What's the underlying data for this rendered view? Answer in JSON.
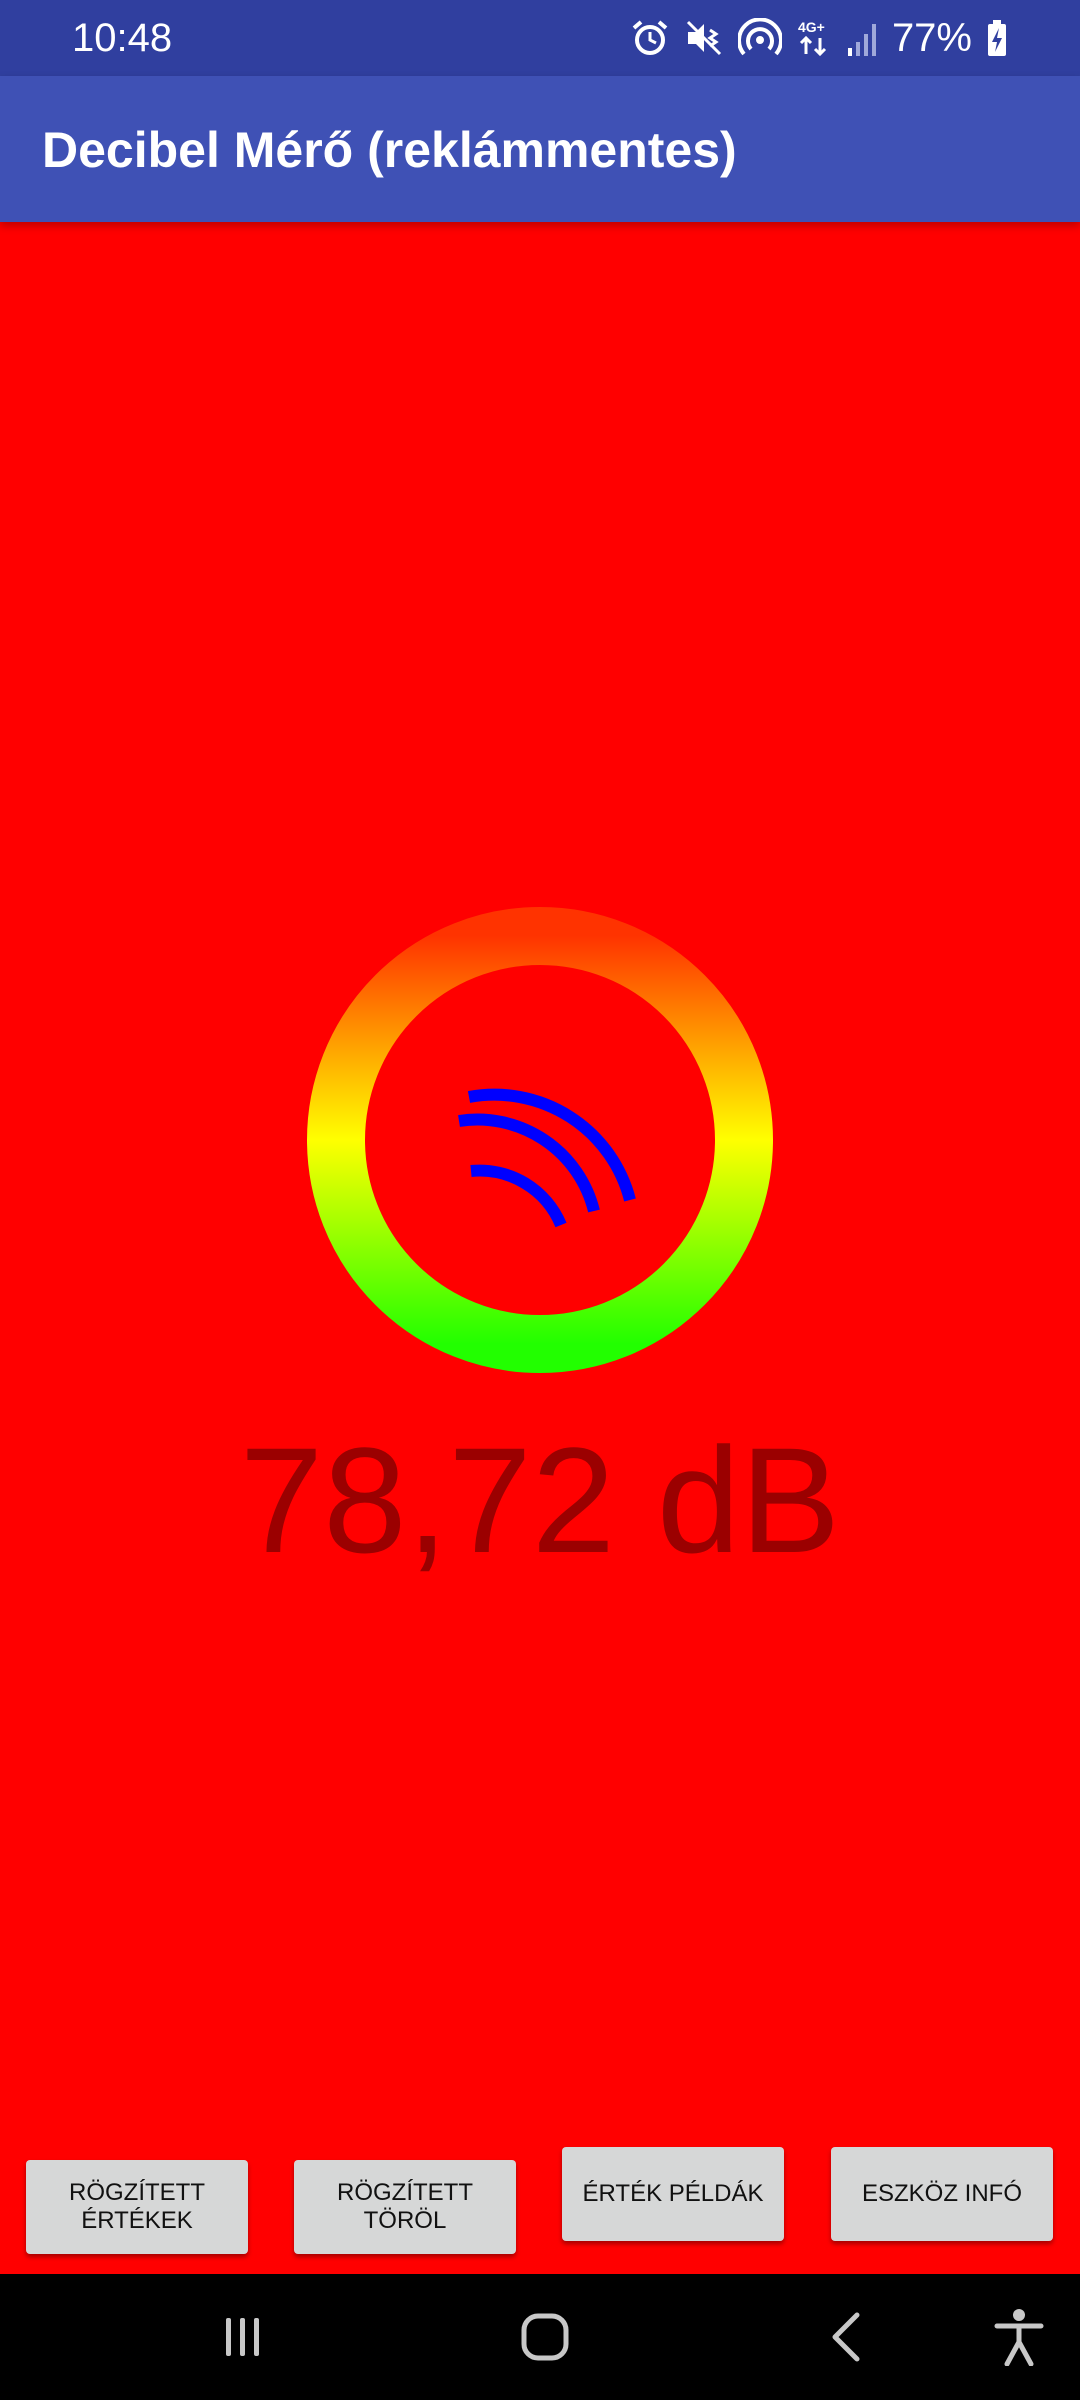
{
  "status_bar": {
    "time": "10:48",
    "network": "4G+",
    "battery_percent": "77%",
    "icons": [
      "alarm-icon",
      "mute-vibrate-icon",
      "hotspot-icon",
      "network-4g-icon",
      "signal-icon",
      "battery-charging-icon"
    ]
  },
  "app_bar": {
    "title": "Decibel Mérő (reklámmentes)",
    "color": "#3f51b5"
  },
  "meter": {
    "background_color": "#ff0000",
    "ring_gradient": [
      "#ff3300",
      "#ffff00",
      "#22ff00"
    ],
    "icon": "sound-waves-icon",
    "icon_color": "#0000ff"
  },
  "reading": {
    "value": "78,72 dB"
  },
  "buttons": {
    "recorded_values": "RÖGZÍTETT\nÉRTÉKEK",
    "recorded_delete": "RÖGZÍTETT\nTÖRÖL",
    "value_examples": "ÉRTÉK PÉLDÁK",
    "device_info": "ESZKÖZ INFÓ"
  },
  "nav_bar": {
    "icons": [
      "recent-apps-icon",
      "home-icon",
      "back-icon",
      "accessibility-icon"
    ]
  }
}
